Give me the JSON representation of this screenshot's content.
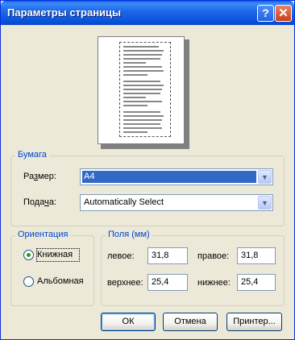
{
  "window": {
    "title": "Параметры страницы",
    "help_label": "?",
    "close_label": "✕",
    "help_icon": "help-icon",
    "close_icon": "close-icon",
    "titlebar_color": "#0a55dd"
  },
  "paper": {
    "legend": "Бумага",
    "size_label_pre": "Ра",
    "size_label_key": "з",
    "size_label_post": "мер:",
    "size_value": "A4",
    "source_label_pre": "Пода",
    "source_label_key": "ч",
    "source_label_post": "а:",
    "source_value": "Automatically Select"
  },
  "orientation": {
    "legend": "Ориентация",
    "portrait_label": "Книжная",
    "landscape_label": "Альбомная",
    "selected": "portrait"
  },
  "margins": {
    "legend": "Поля (мм)",
    "left_label": "левое:",
    "left_value": "31,8",
    "right_label": "правое:",
    "right_value": "31,8",
    "top_label": "верхнее:",
    "top_value": "25,4",
    "bottom_label": "нижнее:",
    "bottom_value": "25,4"
  },
  "buttons": {
    "ok": "ОК",
    "cancel": "Отмена",
    "printer": "Принтер..."
  },
  "colors": {
    "accent": "#0046d5",
    "selection": "#316ac5",
    "dialog_bg": "#ece9d8"
  }
}
